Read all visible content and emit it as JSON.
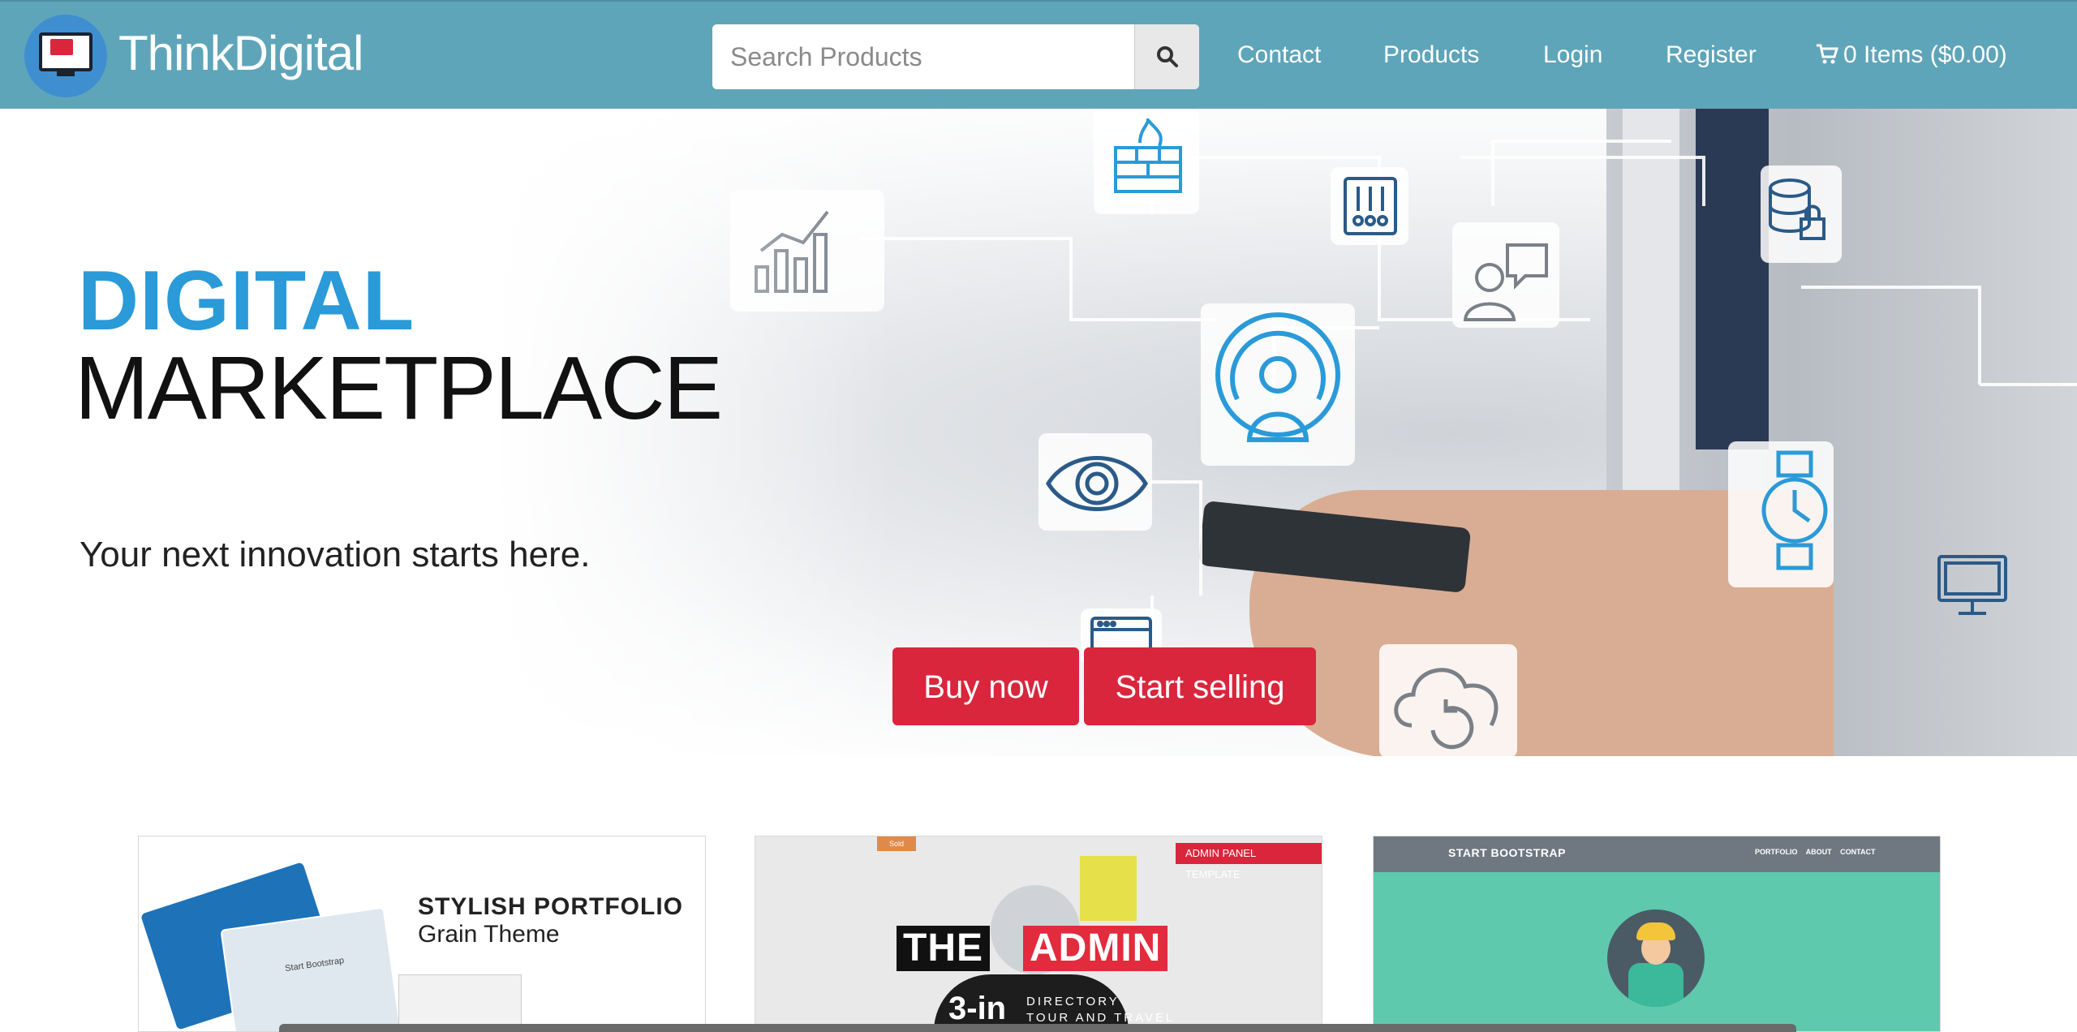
{
  "navbar": {
    "brand": "ThinkDigital",
    "search_placeholder": "Search Products",
    "links": [
      "Contact",
      "Products",
      "Login",
      "Register"
    ],
    "cart_label": "0 Items ($0.00)"
  },
  "hero": {
    "title_line1": "DIGITAL",
    "title_line2": "MARKETPLACE",
    "tagline": "Your next innovation starts here.",
    "buy_label": "Buy now",
    "sell_label": "Start selling"
  },
  "products": [
    {
      "title": "STYLISH PORTFOLIO",
      "subtitle": "Grain Theme",
      "mini": "Start Bootstrap"
    },
    {
      "badge": "ADMIN PANEL TEMPLATE",
      "title_a": "THE",
      "title_b": "ADMIN",
      "num": "3-in",
      "sub": "DIRECTORY\nTOUR AND TRAVEL",
      "tab": "Sold"
    },
    {
      "brand": "START BOOTSTRAP",
      "menu": "PORTFOLIO ABOUT CONTACT"
    }
  ],
  "colors": {
    "navbar": "#5fa5b9",
    "accent_red": "#d9263c",
    "hero_blue": "#2a9ad8"
  }
}
